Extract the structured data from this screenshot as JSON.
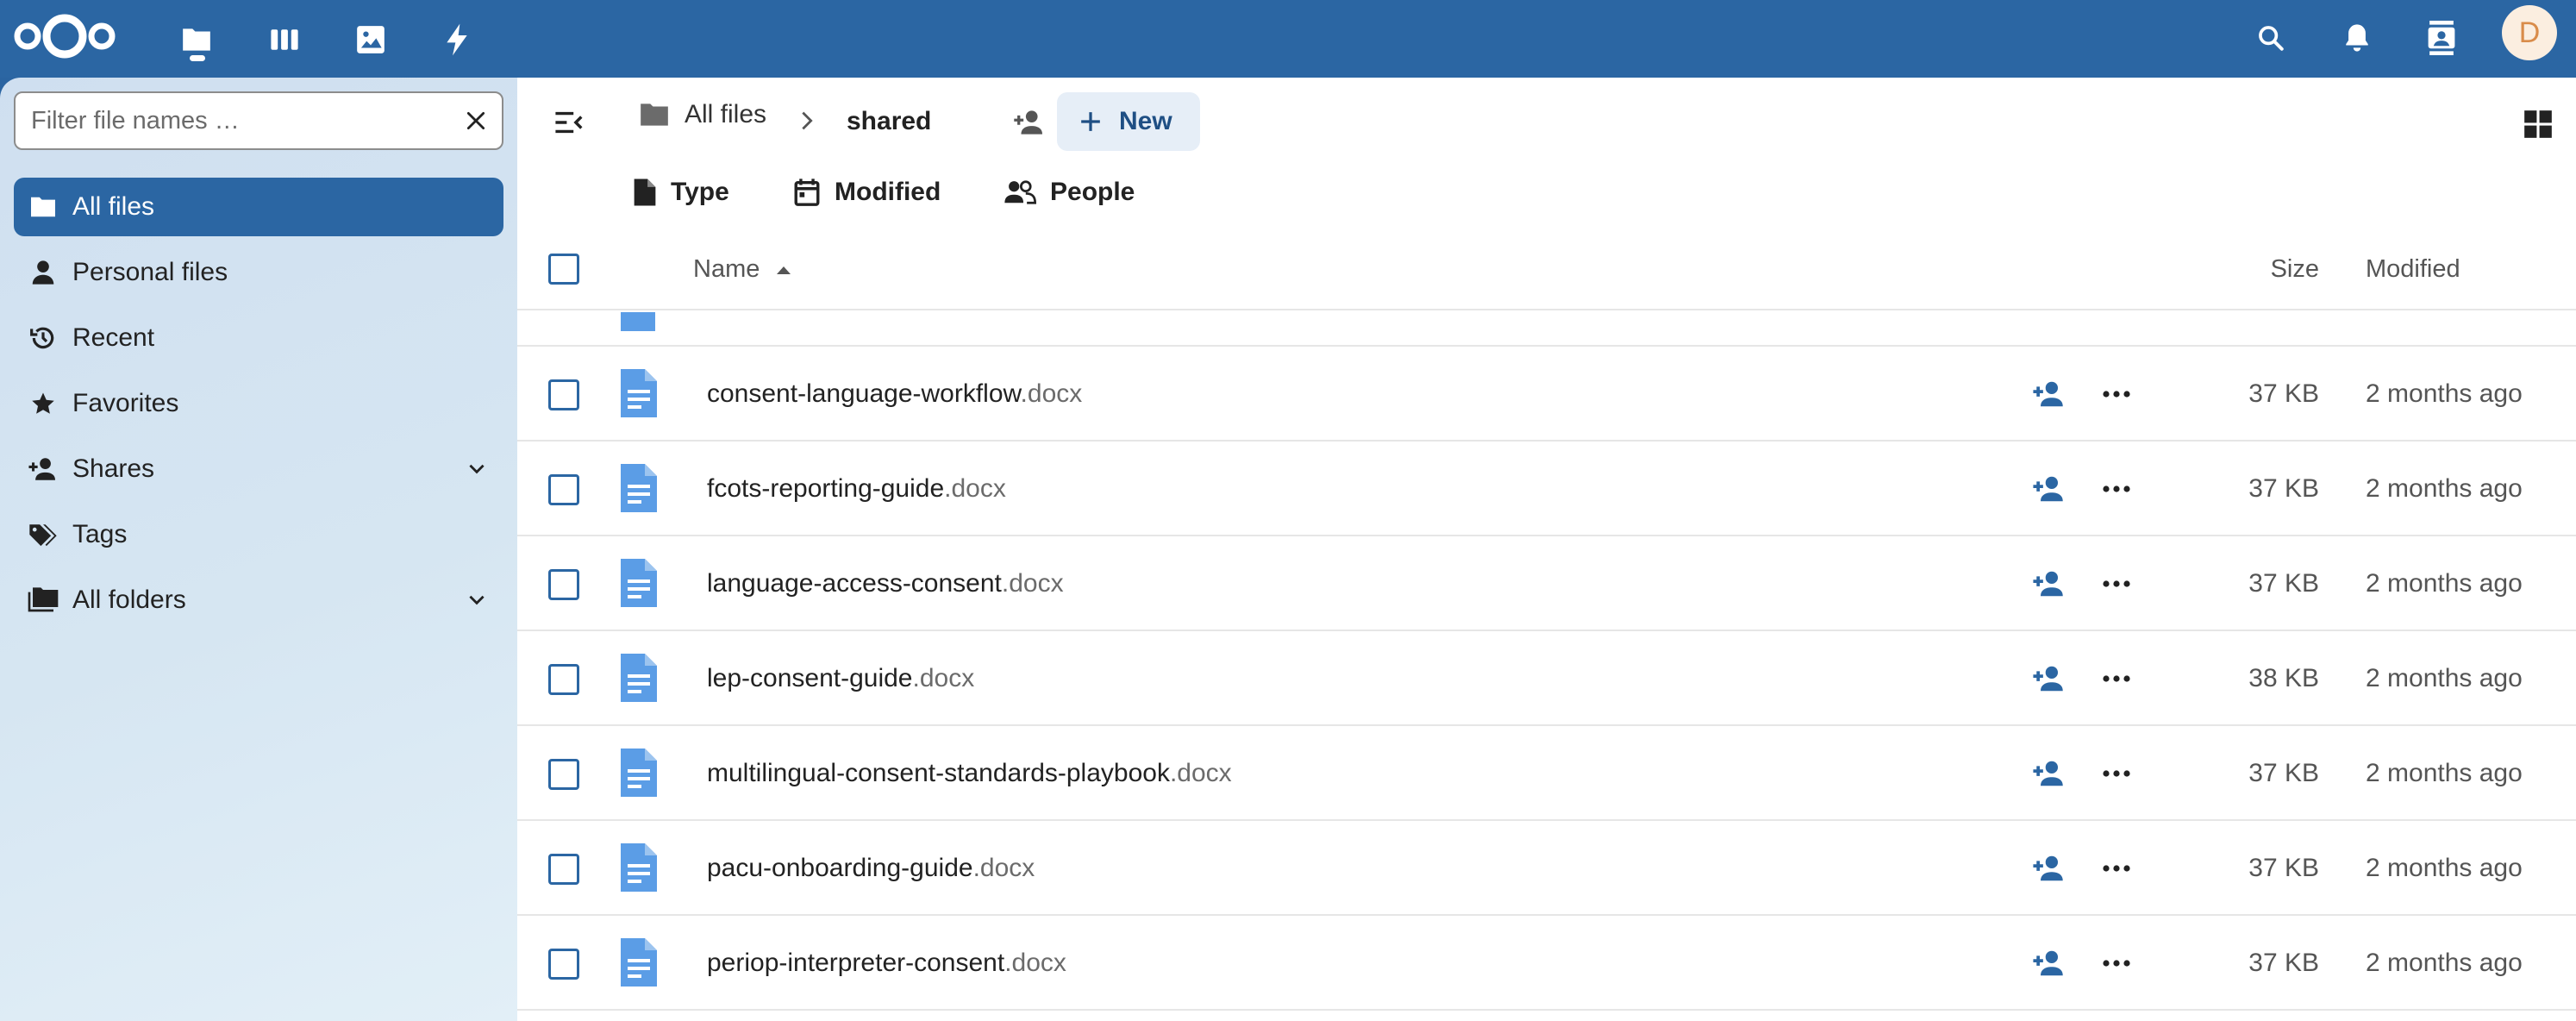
{
  "colors": {
    "header": "#2b66a3",
    "accent": "#2b66a3",
    "new_button_bg": "#e6eef7",
    "file_icon": "#5b9de6"
  },
  "header": {
    "logo": "nextcloud-logo",
    "apps": [
      "files-icon",
      "deck-icon",
      "photos-icon",
      "activity-icon"
    ],
    "right_icons": [
      "search-icon",
      "notifications-bell-icon",
      "contacts-icon"
    ],
    "avatar_initial": "D"
  },
  "sidebar": {
    "filter_placeholder": "Filter file names …",
    "items": [
      {
        "label": "All files",
        "icon": "folder-icon",
        "active": true
      },
      {
        "label": "Personal files",
        "icon": "person-icon"
      },
      {
        "label": "Recent",
        "icon": "history-icon"
      },
      {
        "label": "Favorites",
        "icon": "star-icon"
      },
      {
        "label": "Shares",
        "icon": "share-person-icon",
        "expandable": true
      },
      {
        "label": "Tags",
        "icon": "tags-icon"
      },
      {
        "label": "All folders",
        "icon": "folders-icon",
        "expandable": true
      }
    ]
  },
  "breadcrumb": {
    "root": "All files",
    "current": "shared"
  },
  "toolbar": {
    "new_label": "New"
  },
  "filters": {
    "type": "Type",
    "modified": "Modified",
    "people": "People"
  },
  "table": {
    "columns": {
      "name": "Name",
      "size": "Size",
      "modified": "Modified"
    },
    "rows": [
      {
        "name": "consent-language-workflow",
        "ext": ".docx",
        "size": "37 KB",
        "modified": "2 months ago"
      },
      {
        "name": "fcots-reporting-guide",
        "ext": ".docx",
        "size": "37 KB",
        "modified": "2 months ago"
      },
      {
        "name": "language-access-consent",
        "ext": ".docx",
        "size": "37 KB",
        "modified": "2 months ago"
      },
      {
        "name": "lep-consent-guide",
        "ext": ".docx",
        "size": "38 KB",
        "modified": "2 months ago"
      },
      {
        "name": "multilingual-consent-standards-playbook",
        "ext": ".docx",
        "size": "37 KB",
        "modified": "2 months ago"
      },
      {
        "name": "pacu-onboarding-guide",
        "ext": ".docx",
        "size": "37 KB",
        "modified": "2 months ago"
      },
      {
        "name": "periop-interpreter-consent",
        "ext": ".docx",
        "size": "37 KB",
        "modified": "2 months ago"
      }
    ]
  }
}
